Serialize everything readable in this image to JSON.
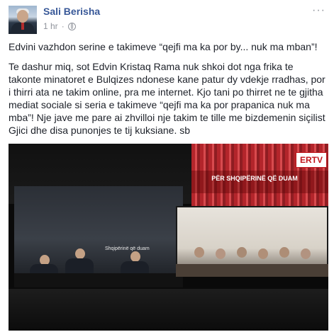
{
  "post": {
    "author": "Sali Berisha",
    "time": "1 hr",
    "separator": "·",
    "menu_glyph": "···",
    "privacy_icon": "globe-icon",
    "paragraph1": "Edvini vazhdon serine e takimeve “qejfi ma ka por by... nuk ma mban”!",
    "paragraph2": "Te dashur miq, sot Edvin Kristaq Rama nuk shkoi dot nga frika te takonte minatoret e Bulqizes ndonese kane patur dy vdekje rradhas, por i thirri ata ne takim online, pra me internet. Kjo tani po thirret ne te gjitha mediat sociale si seria e takimeve “qejfi ma ka por prapanica nuk ma mba”! Nje jave me pare ai zhvilloi nje takim te tille me bizdemenin siçilist Gjici dhe disa punonjes te tij kuksiane. sb"
  },
  "photo": {
    "channel_logo": "ERTV",
    "banner_text": "PËR SHQIPËRINË QË DUAM",
    "screen_text": "Shqipërinë që duam"
  },
  "colors": {
    "author": "#385898",
    "meta": "#90949c",
    "text": "#1d2129",
    "brand_red": "#c0161c"
  }
}
